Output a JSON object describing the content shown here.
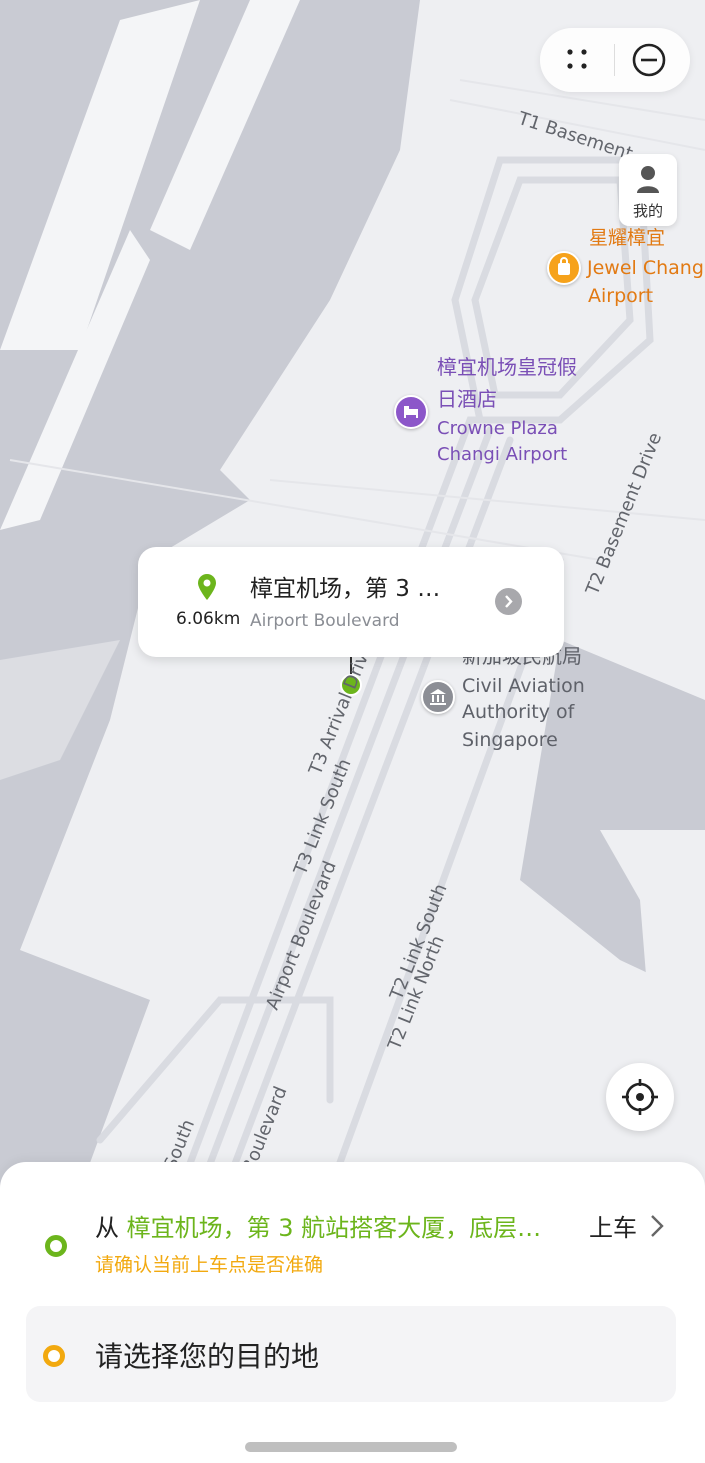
{
  "map": {
    "poi_jewel": {
      "zh": "星耀樟宜",
      "en_line1": "Jewel Changi",
      "en_line2": "Airport",
      "icon": "shopping-bag-icon"
    },
    "poi_crowne": {
      "zh_line1": "樟宜机场皇冠假",
      "zh_line2": "日酒店",
      "en_line1": "Crowne Plaza",
      "en_line2": "Changi Airport",
      "icon": "hotel-bed-icon"
    },
    "poi_caas": {
      "zh": "新加坡民航局",
      "en_line1": "Civil Aviation",
      "en_line2": "Authority of",
      "en_line3": "Singapore",
      "icon": "government-building-icon"
    },
    "roads": {
      "t1_basement": "T1 Basement",
      "t2_basement_drive": "T2 Basement Drive",
      "t3_arrival": "T3 Arrival Driv",
      "t3_link_south": "T3 Link South",
      "airport_boulevard": "Airport Boulevard",
      "t2_link_south": "T2 Link South",
      "t2_link_north": "T2 Link North",
      "south_partial": "South",
      "boulevard_partial": "Boulevard"
    },
    "colors": {
      "water": "#c9cbd3",
      "land": "#eeeff2",
      "pin": "#6cb51c"
    }
  },
  "me_button": {
    "label": "我的",
    "icon": "person-icon"
  },
  "callout": {
    "title": "樟宜机场，第 3 …",
    "subtitle": "Airport Boulevard",
    "distance": "6.06km",
    "icon": "location-pin-icon"
  },
  "sheet": {
    "from_prefix": "从",
    "pickup_place": "樟宜机场，第 3 航站搭客大厦，底层…",
    "pickup_suffix": "上车",
    "confirm_hint": "请确认当前上车点是否准确",
    "destination_placeholder": "请选择您的目的地",
    "colors": {
      "green": "#6cb51c",
      "orange": "#f2a90f"
    }
  }
}
